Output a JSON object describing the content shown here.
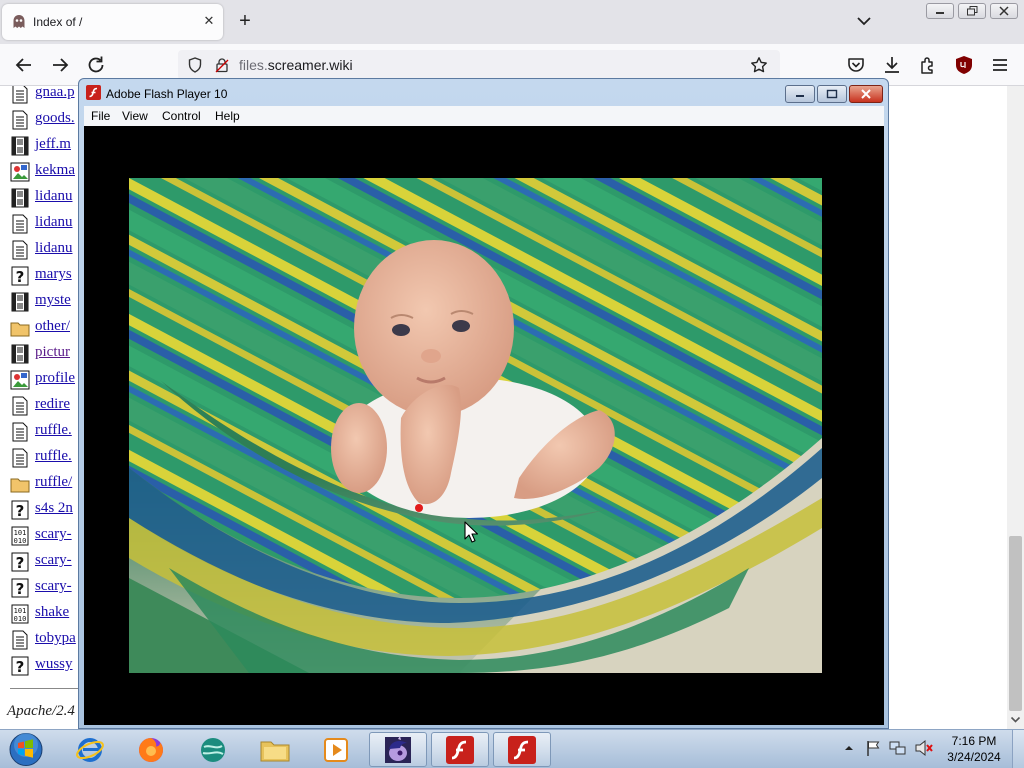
{
  "browser": {
    "tab_title": "Index of /",
    "url_domain": "files.",
    "url_host": "screamer.wiki"
  },
  "files": [
    {
      "name": "gnaa.p",
      "icon": "document-icon"
    },
    {
      "name": "goods.",
      "icon": "document-icon"
    },
    {
      "name": "jeff.m",
      "icon": "video-icon"
    },
    {
      "name": "kekma",
      "icon": "image-icon"
    },
    {
      "name": "lidanu",
      "icon": "video-icon"
    },
    {
      "name": "lidanu",
      "icon": "document-icon"
    },
    {
      "name": "lidanu",
      "icon": "document-icon"
    },
    {
      "name": "marys",
      "icon": "unknown-icon"
    },
    {
      "name": "myste",
      "icon": "video-icon"
    },
    {
      "name": "other/",
      "icon": "folder-icon"
    },
    {
      "name": "pictur",
      "icon": "video-icon"
    },
    {
      "name": "profile",
      "icon": "image-icon"
    },
    {
      "name": "redire",
      "icon": "document-icon"
    },
    {
      "name": "ruffle.",
      "icon": "document-icon"
    },
    {
      "name": "ruffle.",
      "icon": "document-icon"
    },
    {
      "name": "ruffle/",
      "icon": "folder-icon"
    },
    {
      "name": "s4s 2n",
      "icon": "unknown-icon"
    },
    {
      "name": "scary-",
      "icon": "binary-icon"
    },
    {
      "name": "scary-",
      "icon": "unknown-icon"
    },
    {
      "name": "scary-",
      "icon": "unknown-icon"
    },
    {
      "name": "shake",
      "icon": "binary-icon"
    },
    {
      "name": "tobypa",
      "icon": "document-icon"
    },
    {
      "name": "wussy",
      "icon": "unknown-icon"
    }
  ],
  "footer": "Apache/2.4",
  "flash_window": {
    "title": "Adobe Flash Player 10",
    "menu": [
      "File",
      "View",
      "Control",
      "Help"
    ]
  },
  "taskbar": {
    "time": "7:16 PM",
    "date": "3/24/2024"
  },
  "colors": {
    "link": "#1a0dab",
    "flash_red": "#c8211b",
    "stage": "#000000"
  }
}
